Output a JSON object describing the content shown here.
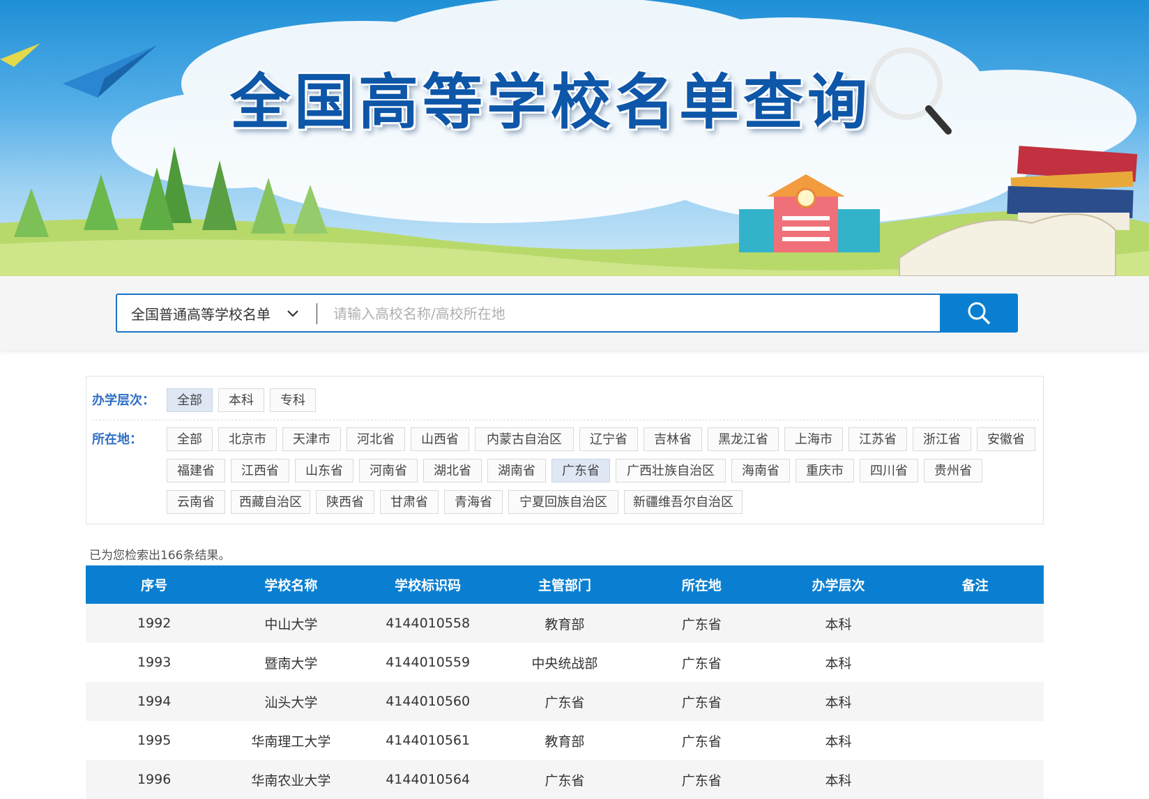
{
  "banner": {
    "title": "全国高等学校名单查询"
  },
  "search": {
    "select_label": "全国普通高等学校名单",
    "placeholder": "请输入高校名称/高校所在地",
    "icons": {
      "dropdown": "chevron-down-icon",
      "submit": "search-icon"
    }
  },
  "filters": {
    "level": {
      "label": "办学层次：",
      "options": [
        "全部",
        "本科",
        "专科"
      ],
      "selected": "全部"
    },
    "location": {
      "label": "所在地：",
      "options": [
        "全部",
        "北京市",
        "天津市",
        "河北省",
        "山西省",
        "内蒙古自治区",
        "辽宁省",
        "吉林省",
        "黑龙江省",
        "上海市",
        "江苏省",
        "浙江省",
        "安徽省",
        "福建省",
        "江西省",
        "山东省",
        "河南省",
        "湖北省",
        "湖南省",
        "广东省",
        "广西壮族自治区",
        "海南省",
        "重庆市",
        "四川省",
        "贵州省",
        "云南省",
        "西藏自治区",
        "陕西省",
        "甘肃省",
        "青海省",
        "宁夏回族自治区",
        "新疆维吾尔自治区"
      ],
      "selected": "广东省"
    }
  },
  "results": {
    "count_text": "已为您检索出166条结果。",
    "headers": [
      "序号",
      "学校名称",
      "学校标识码",
      "主管部门",
      "所在地",
      "办学层次",
      "备注"
    ],
    "rows": [
      [
        "1992",
        "中山大学",
        "4144010558",
        "教育部",
        "广东省",
        "本科",
        ""
      ],
      [
        "1993",
        "暨南大学",
        "4144010559",
        "中央统战部",
        "广东省",
        "本科",
        ""
      ],
      [
        "1994",
        "汕头大学",
        "4144010560",
        "广东省",
        "广东省",
        "本科",
        ""
      ],
      [
        "1995",
        "华南理工大学",
        "4144010561",
        "教育部",
        "广东省",
        "本科",
        ""
      ],
      [
        "1996",
        "华南农业大学",
        "4144010564",
        "广东省",
        "广东省",
        "本科",
        ""
      ]
    ]
  },
  "colors": {
    "primary": "#0a7fd1",
    "label": "#2f6fc4",
    "active_tag": "#dfe7f5"
  }
}
